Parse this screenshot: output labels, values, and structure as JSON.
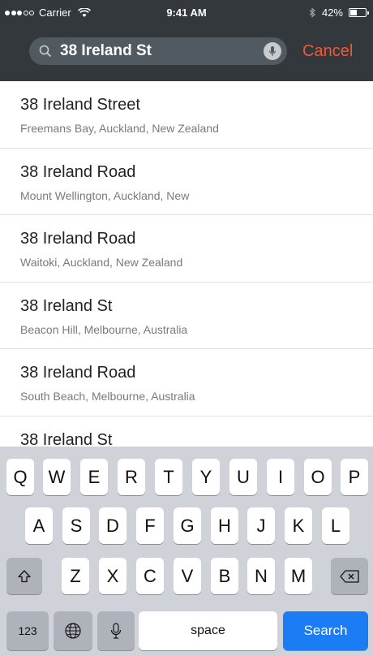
{
  "status_bar": {
    "carrier": "Carrier",
    "time": "9:41 AM",
    "battery": "42%"
  },
  "search": {
    "value": "38 Ireland St",
    "cancel_label": "Cancel"
  },
  "results": [
    {
      "title": "38 Ireland Street",
      "subtitle": "Freemans Bay, Auckland, New Zealand"
    },
    {
      "title": "38 Ireland Road",
      "subtitle": "Mount Wellington, Auckland, New"
    },
    {
      "title": "38 Ireland Road",
      "subtitle": "Waitoki, Auckland, New Zealand"
    },
    {
      "title": "38 Ireland St",
      "subtitle": "Beacon Hill, Melbourne, Australia"
    },
    {
      "title": "38 Ireland Road",
      "subtitle": "South Beach, Melbourne, Australia"
    },
    {
      "title": "38 Ireland St",
      "subtitle": ""
    }
  ],
  "keyboard": {
    "row1": [
      "Q",
      "W",
      "E",
      "R",
      "T",
      "Y",
      "U",
      "I",
      "O",
      "P"
    ],
    "row2": [
      "A",
      "S",
      "D",
      "F",
      "G",
      "H",
      "J",
      "K",
      "L"
    ],
    "row3": [
      "Z",
      "X",
      "C",
      "V",
      "B",
      "N",
      "M"
    ],
    "numbers_label": "123",
    "space_label": "space",
    "search_label": "Search"
  },
  "colors": {
    "header": "#33383d",
    "accent": "#ef5a34",
    "search_key": "#1c7cf4"
  }
}
